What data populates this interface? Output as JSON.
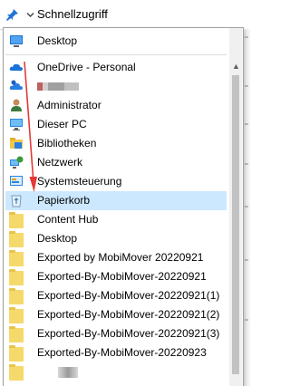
{
  "topbar": {
    "title": "Schnellzugriff"
  },
  "dropdown": {
    "items": [
      {
        "label": "Desktop",
        "icon": "desktop-icon",
        "selected": false
      },
      {
        "label": "OneDrive - Personal",
        "icon": "onedrive-icon",
        "selected": false
      },
      {
        "label": "",
        "icon": "user-cloud-icon",
        "selected": false
      },
      {
        "label": "Administrator",
        "icon": "user-icon",
        "selected": false
      },
      {
        "label": "Dieser PC",
        "icon": "computer-icon",
        "selected": false
      },
      {
        "label": "Bibliotheken",
        "icon": "libraries-icon",
        "selected": false
      },
      {
        "label": "Netzwerk",
        "icon": "network-icon",
        "selected": false
      },
      {
        "label": "Systemsteuerung",
        "icon": "control-panel-icon",
        "selected": false
      },
      {
        "label": "Papierkorb",
        "icon": "recycle-bin-icon",
        "selected": true
      },
      {
        "label": "Content Hub",
        "icon": "folder-icon",
        "selected": false
      },
      {
        "label": "Desktop",
        "icon": "folder-icon",
        "selected": false
      },
      {
        "label": "Exported by MobiMover 20220921",
        "icon": "folder-icon",
        "selected": false
      },
      {
        "label": "Exported-By-MobiMover-20220921",
        "icon": "folder-icon",
        "selected": false
      },
      {
        "label": "Exported-By-MobiMover-20220921(1)",
        "icon": "folder-icon",
        "selected": false
      },
      {
        "label": "Exported-By-MobiMover-20220921(2)",
        "icon": "folder-icon",
        "selected": false
      },
      {
        "label": "Exported-By-MobiMover-20220921(3)",
        "icon": "folder-icon",
        "selected": false
      },
      {
        "label": "Exported-By-MobiMover-20220923",
        "icon": "folder-icon",
        "selected": false
      },
      {
        "label": "",
        "icon": "folder-icon",
        "selected": false
      }
    ]
  },
  "colors": {
    "selection": "#cce8ff",
    "arrow": "#e53935",
    "folder": "#f5d96b"
  }
}
